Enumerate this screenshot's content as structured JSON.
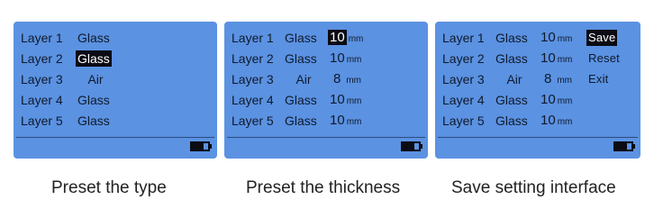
{
  "panels": [
    {
      "layers": [
        {
          "label": "Layer 1",
          "type": "Glass"
        },
        {
          "label": "Layer 2",
          "type": "Glass"
        },
        {
          "label": "Layer 3",
          "type": "Air"
        },
        {
          "label": "Layer 4",
          "type": "Glass"
        },
        {
          "label": "Layer 5",
          "type": "Glass"
        }
      ],
      "caption": "Preset the type"
    },
    {
      "layers": [
        {
          "label": "Layer 1",
          "type": "Glass",
          "thickness": "10",
          "unit": "mm"
        },
        {
          "label": "Layer 2",
          "type": "Glass",
          "thickness": "10",
          "unit": "mm"
        },
        {
          "label": "Layer 3",
          "type": "Air",
          "thickness": "8",
          "unit": "mm"
        },
        {
          "label": "Layer 4",
          "type": "Glass",
          "thickness": "10",
          "unit": "mm"
        },
        {
          "label": "Layer 5",
          "type": "Glass",
          "thickness": "10",
          "unit": "mm"
        }
      ],
      "caption": "Preset the thickness"
    },
    {
      "layers": [
        {
          "label": "Layer 1",
          "type": "Glass",
          "thickness": "10",
          "unit": "mm"
        },
        {
          "label": "Layer 2",
          "type": "Glass",
          "thickness": "10",
          "unit": "mm"
        },
        {
          "label": "Layer 3",
          "type": "Air",
          "thickness": "8",
          "unit": "mm"
        },
        {
          "label": "Layer 4",
          "type": "Glass",
          "thickness": "10",
          "unit": "mm"
        },
        {
          "label": "Layer 5",
          "type": "Glass",
          "thickness": "10",
          "unit": "mm"
        }
      ],
      "menu": {
        "save": "Save",
        "reset": "Reset",
        "exit": "Exit"
      },
      "caption": "Save setting interface"
    }
  ],
  "colors": {
    "screen": "#5b92e2",
    "highlight": "#0b0b14",
    "text": "#101a2c"
  },
  "icons": {
    "battery": "battery-icon"
  }
}
